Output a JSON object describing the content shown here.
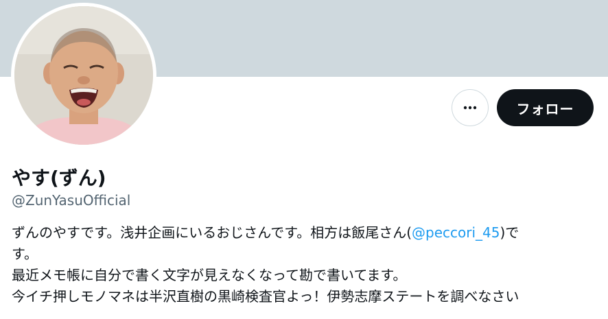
{
  "profile": {
    "display_name": "やす(ずん)",
    "handle": "@ZunYasuOfficial"
  },
  "actions": {
    "more_icon": "more-horizontal-icon",
    "follow_label": "フォロー"
  },
  "bio": {
    "line1_prefix": "ずんのやすです。浅井企画にいるおじさんです。相方は飯尾さん(",
    "line1_mention": "@peccori_45",
    "line1_suffix": ")で",
    "line2": "す。",
    "line3": "最近メモ帳に自分で書く文字が見えなくなって勘で書いてます。",
    "line4": "今イチ押しモノマネは半沢直樹の黒崎検査官よっ！伊勢志摩ステートを調べなさい"
  },
  "colors": {
    "banner": "#cfd9de",
    "primary_text": "#0f1419",
    "secondary_text": "#536471",
    "link": "#1d9bf0",
    "follow_bg": "#0f1419"
  }
}
